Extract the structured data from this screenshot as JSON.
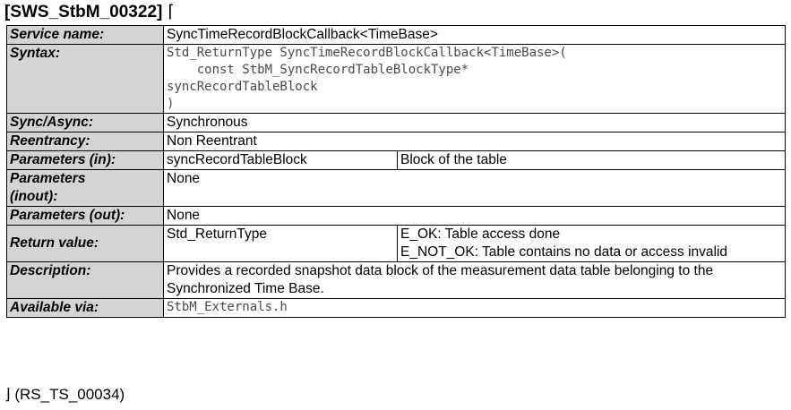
{
  "requirement": {
    "id": "[SWS_StbM_00322]",
    "open_bracket": "⌈",
    "trace": "⌋ (RS_TS_00034)"
  },
  "table": {
    "service_name": {
      "label": "Service name:",
      "value": "SyncTimeRecordBlockCallback<TimeBase>"
    },
    "syntax": {
      "label": "Syntax:",
      "lines": [
        "Std_ReturnType SyncTimeRecordBlockCallback<TimeBase>(",
        "    const StbM_SyncRecordTableBlockType*",
        "syncRecordTableBlock",
        ")"
      ]
    },
    "sync_async": {
      "label": "Sync/Async:",
      "value": "Synchronous"
    },
    "reentrancy": {
      "label": "Reentrancy:",
      "value": "Non Reentrant"
    },
    "parameters_in": {
      "label": "Parameters (in):",
      "name": "syncRecordTableBlock",
      "description": "Block of the table"
    },
    "parameters_inout": {
      "label_line1": "Parameters",
      "label_line2": "(inout):",
      "value": "None"
    },
    "parameters_out": {
      "label": "Parameters (out):",
      "value": "None"
    },
    "return_value": {
      "label": "Return value:",
      "type": "Std_ReturnType",
      "values": [
        "E_OK: Table access done",
        "E_NOT_OK: Table contains no data or access invalid"
      ]
    },
    "description": {
      "label": "Description:",
      "text": "Provides a recorded snapshot data block of the measurement data table belonging to the Synchronized Time Base."
    },
    "available_via": {
      "label": "Available via:",
      "value": "StbM_Externals.h"
    }
  },
  "colors": {
    "label_background": "#d4d4d4",
    "code_text": "#4a4a4a"
  }
}
